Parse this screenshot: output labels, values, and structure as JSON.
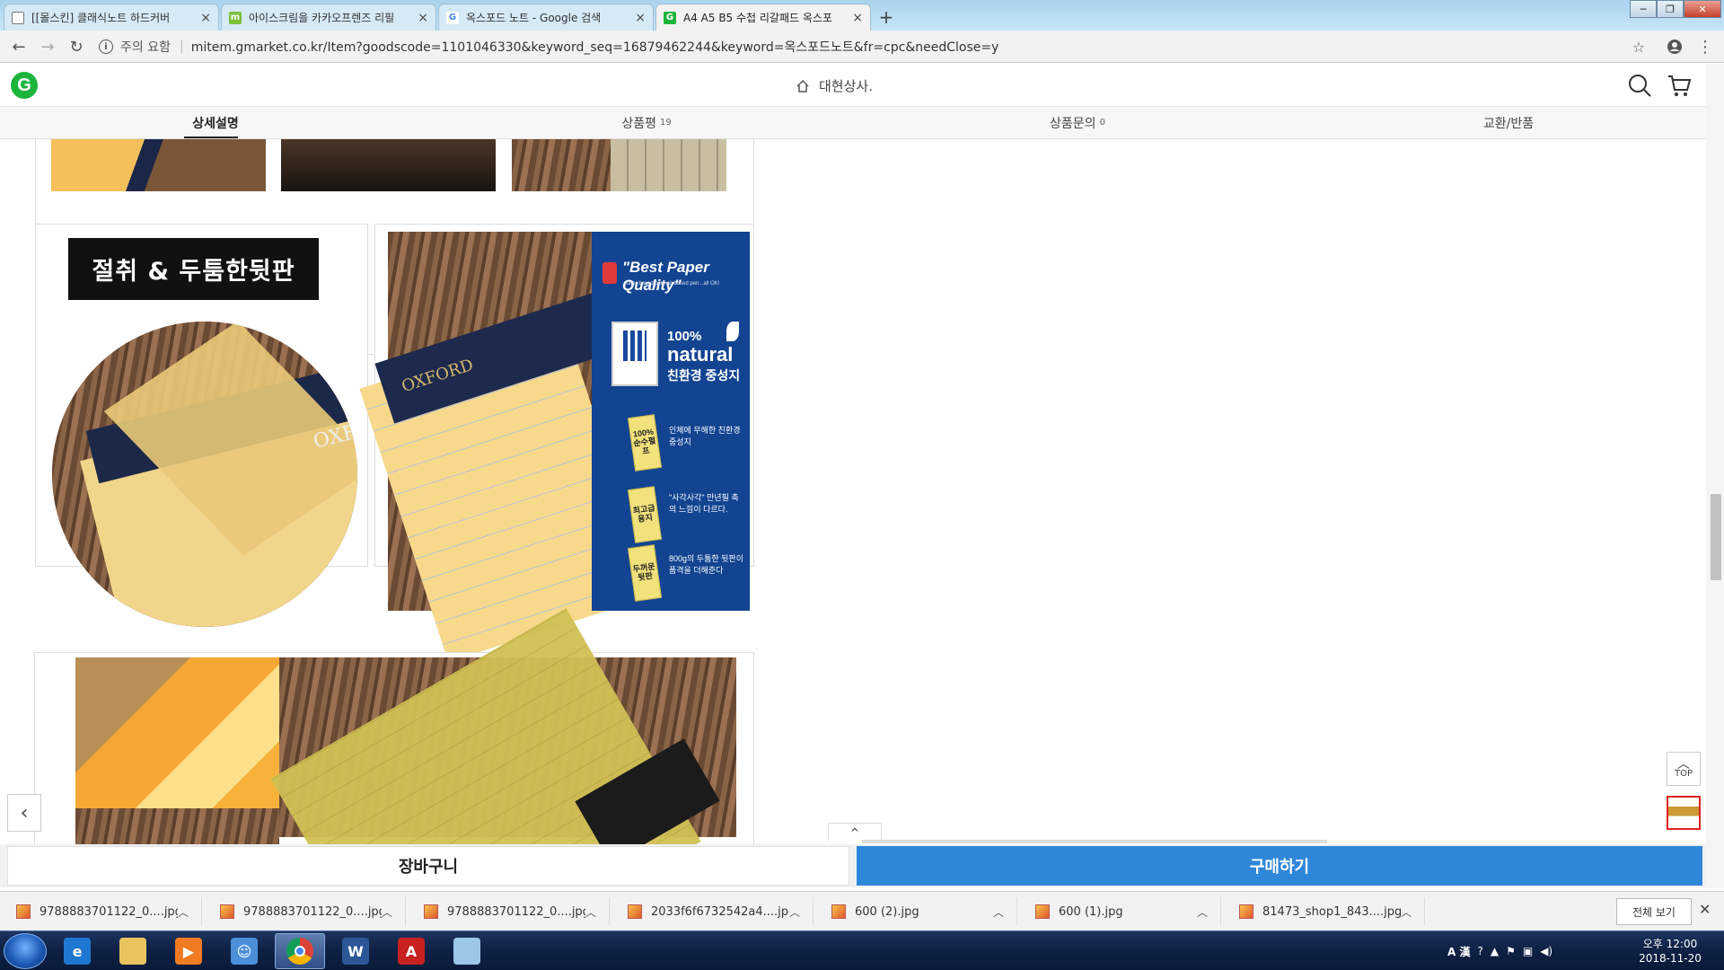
{
  "browser": {
    "tabs": [
      {
        "title": "[[몰스킨] 클래식노트 하드커버",
        "icon": "doc-icon",
        "active": false
      },
      {
        "title": "아이스크림을 카카오프렌즈 리필",
        "icon": "m-favicon-icon",
        "active": false
      },
      {
        "title": "옥스포드 노트 - Google 검색",
        "icon": "google-icon",
        "active": false
      },
      {
        "title": "A4 A5 B5 수첩 리갈패드 옥스포",
        "icon": "gmarket-icon",
        "active": true
      }
    ],
    "new_tab": "+",
    "window_buttons": [
      "─",
      "❐",
      "✕"
    ],
    "security_label": "주의 요함",
    "url": "mitem.gmarket.co.kr/Item?goodscode=1101046330&keyword_seq=16879462244&keyword=옥스포드노트&fr=cpc&needClose=y"
  },
  "site": {
    "logo": "G",
    "shop_name": "대현상사."
  },
  "product_tabs": [
    {
      "label": "상세설명",
      "count": ""
    },
    {
      "label": "상품평",
      "count": "19"
    },
    {
      "label": "상품문의",
      "count": "0"
    },
    {
      "label": "교환/반품",
      "count": ""
    }
  ],
  "content": {
    "badge": "절취 & 두툼한뒷판",
    "brand_print": "OXFORD",
    "panel": {
      "quality": "\"Best Paper Quality\"",
      "quality_sub": "water based pen, oil based pen...all OK!",
      "percent": "100%",
      "natural": "natural",
      "eco": "친환경 중성지",
      "features": [
        {
          "note": "100% 순수펄프",
          "text": "인체에 무해한 친환경 중성지"
        },
        {
          "note": "최고급 용지",
          "text": "\"사각사각\" 만년필 촉의 느낌이 다르다."
        },
        {
          "note": "두꺼운 뒷판",
          "text": "800g의 두툼한 뒷판이 품격을 더해준다"
        }
      ]
    }
  },
  "floating": {
    "top": "TOP",
    "collapse": "^"
  },
  "actions": {
    "cart": "장바구니",
    "buy": "구매하기"
  },
  "downloads": {
    "items": [
      "9788883701122_0....jpg",
      "9788883701122_0....jpg",
      "9788883701122_0....jpg",
      "2033f6f6732542a4....jpg",
      "600 (2).jpg",
      "600 (1).jpg",
      "81473_shop1_843....jpg"
    ],
    "show_all": "전체 보기"
  },
  "taskbar": {
    "apps": [
      "ie-icon",
      "explorer-icon",
      "media-player-icon",
      "people-icon",
      "chrome-icon",
      "word-icon",
      "acrobat-icon",
      "app-icon"
    ],
    "ime": "A 漢",
    "clock_time": "오후 12:00",
    "clock_date": "2018-11-20"
  }
}
